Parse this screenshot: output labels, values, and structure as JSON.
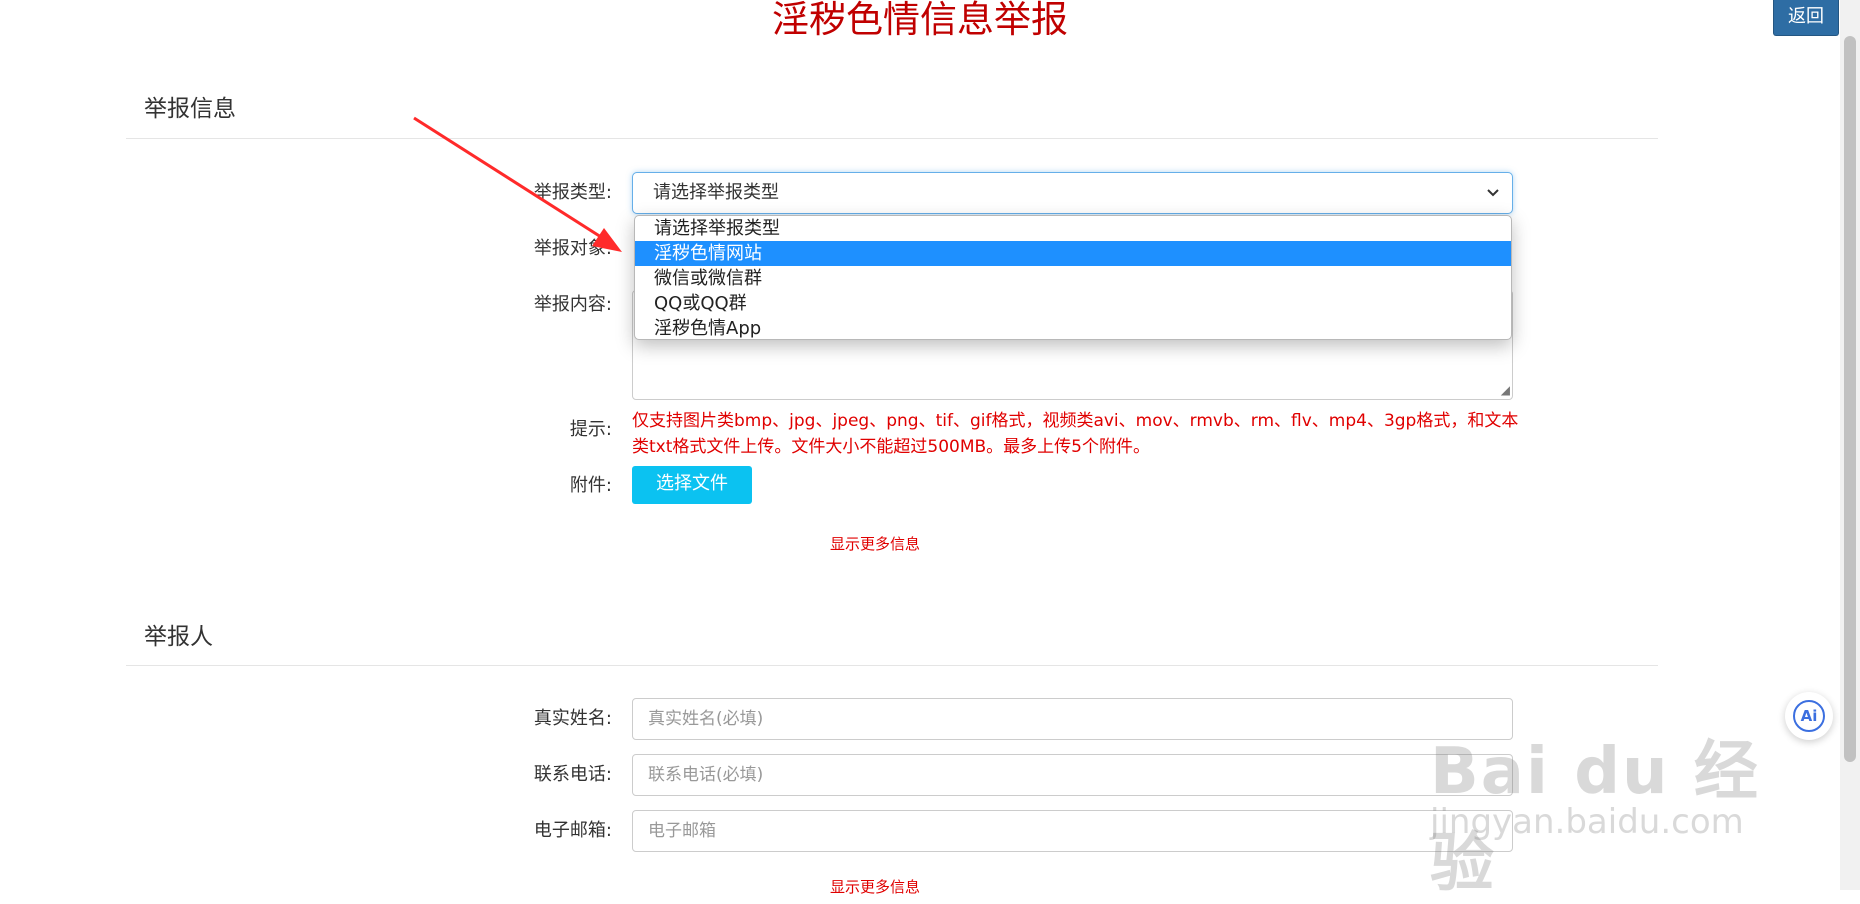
{
  "page": {
    "title": "淫秽色情信息举报",
    "back_label": "返回"
  },
  "report_section": {
    "title": "举报信息",
    "type_label": "举报类型:",
    "type_selected": "请选择举报类型",
    "type_options": [
      "请选择举报类型",
      "淫秽色情网站",
      "微信或微信群",
      "QQ或QQ群",
      "淫秽色情App"
    ],
    "highlighted_option": "淫秽色情网站",
    "target_label": "举报对象:",
    "content_label": "举报内容:",
    "hint_label": "提示:",
    "hint_text": "仅支持图片类bmp、jpg、jpeg、png、tif、gif格式，视频类avi、mov、rmvb、rm、flv、mp4、3gp格式，和文本类txt格式文件上传。文件大小不能超过500MB。最多上传5个附件。",
    "attachment_label": "附件:",
    "choose_file_label": "选择文件",
    "more_info_label": "显示更多信息"
  },
  "reporter_section": {
    "title": "举报人",
    "name_label": "真实姓名:",
    "name_placeholder": "真实姓名(必填)",
    "phone_label": "联系电话:",
    "phone_placeholder": "联系电话(必填)",
    "email_label": "电子邮箱:",
    "email_placeholder": "电子邮箱",
    "more_info_label": "显示更多信息"
  },
  "widgets": {
    "ai_label": "Ai",
    "watermark_main": "Bai du 经验",
    "watermark_sub": "jingyan.baidu.com"
  },
  "colors": {
    "title": "#c00000",
    "back_button": "#2e6da4",
    "highlight": "#1e90ff",
    "file_button": "#0bc2f1",
    "hint": "#e00000",
    "arrow": "#ff2a2a"
  },
  "icons": {
    "select_chevron": "chevron-down-icon",
    "annotation_arrow": "red-arrow-icon",
    "ai_assistant": "ai-icon"
  }
}
